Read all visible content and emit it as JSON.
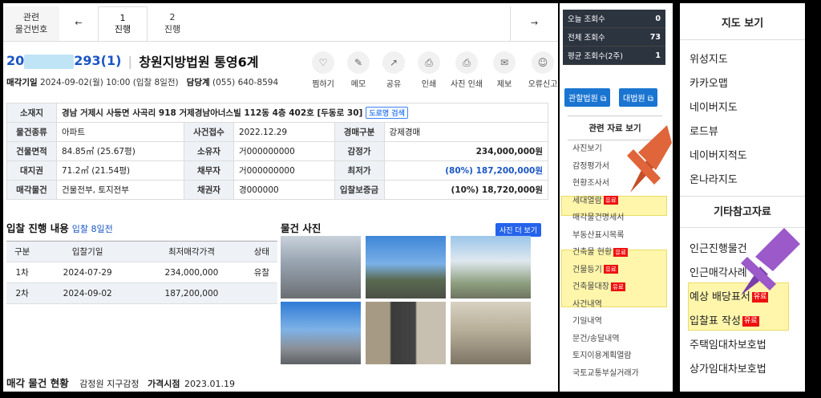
{
  "nav": {
    "related_label_1": "관련",
    "related_label_2": "물건번호",
    "prev_arrow": "←",
    "next_arrow": "→",
    "tabs": [
      {
        "num": "1",
        "label": "진행"
      },
      {
        "num": "2",
        "label": "진행"
      }
    ]
  },
  "title": {
    "case_suffix": "293(1)",
    "case_prefix": "20",
    "court": "창원지방법원 통영6계"
  },
  "sub": {
    "sale_label": "매각기일",
    "sale_value": "2024-09-02(월) 10:00 (입찰 8일전)",
    "dept_label": "담당계",
    "dept_value": "(055) 640-8594"
  },
  "actions": [
    "찜하기",
    "메모",
    "공유",
    "인쇄",
    "사진 인쇄",
    "제보",
    "오류신고"
  ],
  "info": {
    "addr_label": "소재지",
    "addr_value": "경남 거제시 사등면 사곡리 918 거제경남아너스빌 112동 4층 402호 [두동로 30]",
    "addr_btn": "도로명 검색",
    "rows": [
      [
        "물건종류",
        "아파트",
        "사건접수",
        "2022.12.29",
        "경매구분",
        "강제경매"
      ],
      [
        "건물면적",
        "84.85㎡ (25.67평)",
        "소유자",
        "거000000000",
        "감정가",
        "234,000,000원"
      ],
      [
        "대지권",
        "71.2㎡ (21.54평)",
        "채무자",
        "거000000000",
        "최저가",
        "(80%) 187,200,000원"
      ],
      [
        "매각물건",
        "건물전부, 토지전부",
        "채권자",
        "경000000",
        "입찰보증금",
        "(10%) 18,720,000원"
      ]
    ]
  },
  "bid": {
    "title": "입찰 진행 내용",
    "sub": "입찰 8일전",
    "headers": [
      "구분",
      "입찰기일",
      "최저매각가격",
      "상태"
    ],
    "rows": [
      [
        "1차",
        "2024-07-29",
        "234,000,000",
        "유찰"
      ],
      [
        "2차",
        "2024-09-02",
        "187,200,000",
        ""
      ]
    ]
  },
  "photos": {
    "title": "물건 사진",
    "more": "사진 더 보기"
  },
  "footer": {
    "title": "매각 물건 현황",
    "appraiser": "감정원 지구감정",
    "price_label": "가격시점",
    "price_date": "2023.01.19"
  },
  "stats": [
    {
      "label": "오늘 조회수",
      "value": "0"
    },
    {
      "label": "전체 조회수",
      "value": "73"
    },
    {
      "label": "평균 조회수(2주)",
      "value": "1"
    }
  ],
  "court_btns": [
    "관할법원",
    "대법원"
  ],
  "related": {
    "title": "관련 자료 보기",
    "tag": "유료",
    "items": [
      {
        "label": "사진보기",
        "paid": false
      },
      {
        "label": "감정평가서",
        "paid": false
      },
      {
        "label": "현황조사서",
        "paid": false
      },
      {
        "label": "세대열람",
        "paid": true
      },
      {
        "label": "매각물건명세서",
        "paid": false
      },
      {
        "label": "부동산표시목록",
        "paid": false
      },
      {
        "label": "건축물 현황",
        "paid": true
      },
      {
        "label": "건물등기",
        "paid": true
      },
      {
        "label": "건축물대장",
        "paid": true
      },
      {
        "label": "사건내역",
        "paid": false
      },
      {
        "label": "기일내역",
        "paid": false
      },
      {
        "label": "문건/송달내역",
        "paid": false
      },
      {
        "label": "토지이용계획열람",
        "paid": false
      },
      {
        "label": "국토교통부실거래가",
        "paid": false
      }
    ]
  },
  "map": {
    "title": "지도 보기",
    "items": [
      "위성지도",
      "카카오맵",
      "네이버지도",
      "로드뷰",
      "네이버지적도",
      "온나라지도"
    ]
  },
  "other": {
    "title": "기타참고자료",
    "items": [
      {
        "label": "인근진행물건",
        "paid": false
      },
      {
        "label": "인근매각사례",
        "paid": false
      },
      {
        "label": "예상 배당표서",
        "paid": true
      },
      {
        "label": "입찰표 작성",
        "paid": true
      },
      {
        "label": "주택임대차보호법",
        "paid": false
      },
      {
        "label": "상가임대차보호법",
        "paid": false
      }
    ]
  },
  "colors": {
    "accent": "#1a56c5",
    "paid_tag": "#ee1111",
    "highlight": "#fff59d",
    "pin_orange": "#e0653a",
    "pin_purple": "#9b59c9"
  }
}
